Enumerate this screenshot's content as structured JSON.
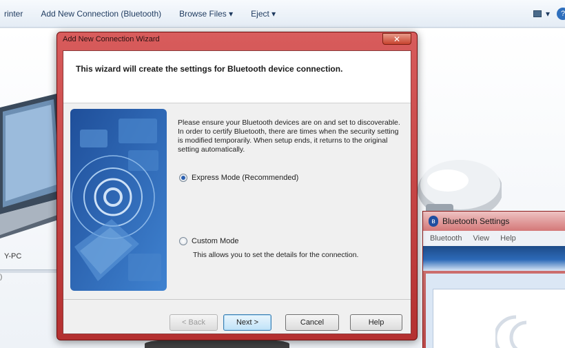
{
  "toolbar": {
    "items": [
      "rinter",
      "Add New Connection (Bluetooth)",
      "Browse Files ▾",
      "Eject ▾"
    ],
    "view_label": "▾",
    "help_label": "?"
  },
  "explorer": {
    "pc_label": "Y-PC",
    "pc_value": ")"
  },
  "bluetooth_settings": {
    "title": "Bluetooth Settings",
    "menu": [
      "Bluetooth",
      "View",
      "Help"
    ]
  },
  "wizard": {
    "title": "Add New Connection Wizard",
    "close_label": "✕",
    "header": "This wizard will create the settings for Bluetooth device connection.",
    "paragraph1": "Please ensure your Bluetooth devices are on and set to discoverable.",
    "paragraph2": "In order to certify Bluetooth, there are times when the security setting is modified temporarily. When setup ends, it returns to the original setting automatically.",
    "express_mode": "Express Mode (Recommended)",
    "custom_mode": "Custom Mode",
    "custom_desc": "This allows you to set the details for the connection.",
    "selected_mode": "Express Mode (Recommended)",
    "buttons": {
      "back": "< Back",
      "next": "Next >",
      "cancel": "Cancel",
      "help": "Help"
    }
  },
  "colors": {
    "title_bar": "#c94a4a",
    "accent_blue": "#2a5fb0"
  }
}
